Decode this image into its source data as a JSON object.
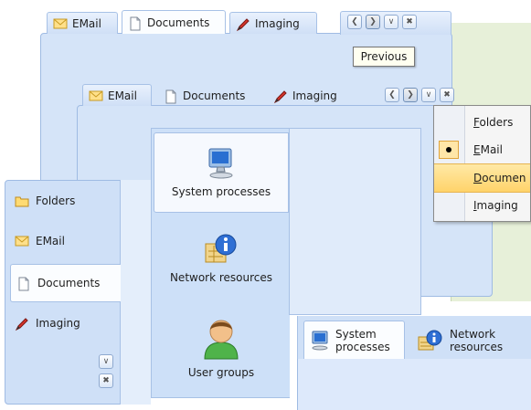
{
  "tabs": {
    "email": "EMail",
    "documents": "Documents",
    "imaging": "Imaging"
  },
  "tooltip": "Previous",
  "menu": {
    "items": [
      {
        "label": "Folders",
        "mnemonic": "F",
        "rest": "olders",
        "checked": false,
        "highlighted": false
      },
      {
        "label": "EMail",
        "mnemonic": "E",
        "rest": "Mail",
        "checked": true,
        "highlighted": false
      },
      {
        "label": "Documen",
        "mnemonic": "D",
        "rest": "ocumen",
        "checked": false,
        "highlighted": true
      },
      {
        "label": "Imaging",
        "mnemonic": "I",
        "rest": "maging",
        "checked": false,
        "highlighted": false
      }
    ]
  },
  "left_tabs": [
    "Folders",
    "EMail",
    "Documents",
    "Imaging"
  ],
  "big_tabs": [
    "System processes",
    "Network resources",
    "User groups"
  ],
  "bottom_tabs": {
    "system": [
      "System",
      "processes"
    ],
    "network": [
      "Network",
      "resources"
    ]
  },
  "colors": {
    "panel": "#cfe0f7",
    "border": "#9fbbe3",
    "highlight": "#ffd76e",
    "green_area": "#e7f0d9"
  }
}
